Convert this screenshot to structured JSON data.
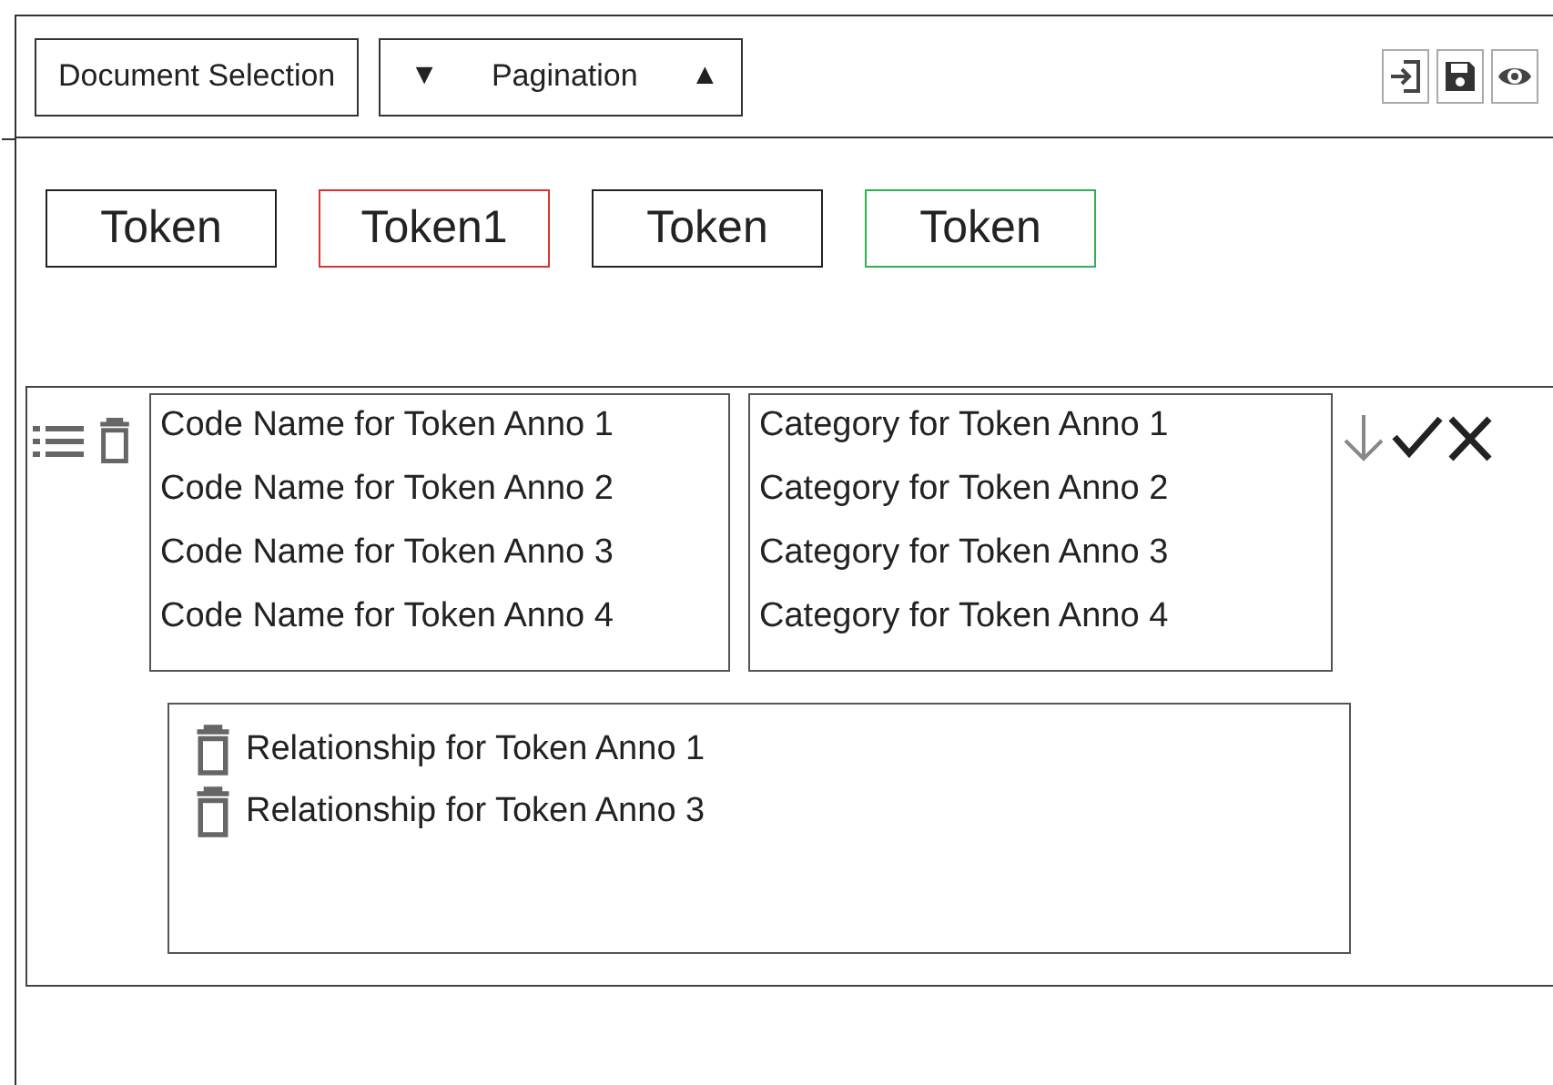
{
  "toolbar": {
    "document_selection": "Document Selection",
    "pagination": {
      "prev": "▼",
      "label": "Pagination",
      "next": "▲"
    }
  },
  "tokens": [
    {
      "label": "Token",
      "color": "#222222"
    },
    {
      "label": "Token1",
      "color": "#e03030"
    },
    {
      "label": "Token",
      "color": "#222222"
    },
    {
      "label": "Token",
      "color": "#30b050"
    }
  ],
  "annotation": {
    "code_names": [
      "Code Name for Token Anno 1",
      "Code Name for Token Anno 2",
      "Code Name for Token Anno 3",
      "Code Name for Token Anno 4"
    ],
    "categories": [
      "Category for Token Anno 1",
      "Category for Token Anno 2",
      "Category for Token Anno 3",
      "Category for Token Anno 4"
    ],
    "relationships": [
      "Relationship for Token Anno 1",
      "Relationship for Token Anno 3"
    ]
  }
}
